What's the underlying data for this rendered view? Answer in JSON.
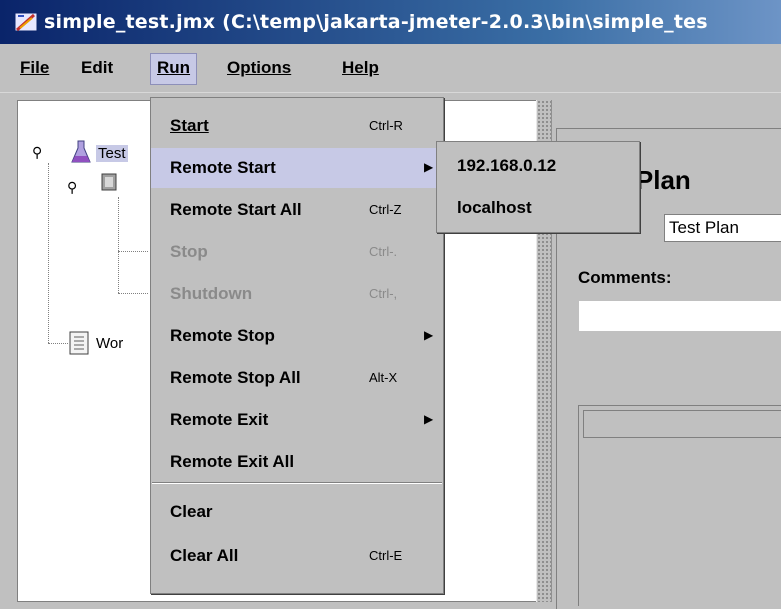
{
  "window": {
    "title": "simple_test.jmx (C:\\temp\\jakarta-jmeter-2.0.3\\bin\\simple_tes"
  },
  "menubar": {
    "items": [
      {
        "key": "file",
        "label": "File"
      },
      {
        "key": "edit",
        "label": "Edit"
      },
      {
        "key": "run",
        "label": "Run",
        "active": true
      },
      {
        "key": "options",
        "label": "Options"
      },
      {
        "key": "help",
        "label": "Help"
      }
    ]
  },
  "run_menu": {
    "items": [
      {
        "label": "Start",
        "accel": "Ctrl-R",
        "enabled": true
      },
      {
        "label": "Remote Start",
        "accel": "",
        "submenu": true,
        "enabled": true,
        "highlighted": true
      },
      {
        "label": "Remote Start All",
        "accel": "Ctrl-Z",
        "enabled": true
      },
      {
        "label": "Stop",
        "accel": "Ctrl-.",
        "enabled": false
      },
      {
        "label": "Shutdown",
        "accel": "Ctrl-,",
        "enabled": false
      },
      {
        "label": "Remote Stop",
        "accel": "",
        "submenu": true,
        "enabled": true
      },
      {
        "label": "Remote Stop All",
        "accel": "Alt-X",
        "enabled": true
      },
      {
        "label": "Remote Exit",
        "accel": "",
        "submenu": true,
        "enabled": true
      },
      {
        "label": "Remote Exit All",
        "accel": "",
        "enabled": true
      },
      {
        "label": "Clear",
        "accel": "",
        "enabled": true
      },
      {
        "label": "Clear All",
        "accel": "Ctrl-E",
        "enabled": true
      }
    ]
  },
  "remote_start_submenu": {
    "items": [
      {
        "label": "192.168.0.12"
      },
      {
        "label": "localhost"
      }
    ]
  },
  "tree": {
    "nodes": [
      {
        "label": "Test"
      },
      {
        "label": "Wor"
      }
    ]
  },
  "editor": {
    "plan_title": ": Plan",
    "name_label": ":",
    "name_value": "Test Plan",
    "comments_label": "Comments:"
  },
  "colors": {
    "menu_highlight": "#c7c9e6",
    "title_bar": "#0a246a",
    "background": "#c0c0c0",
    "disabled_text": "#8a8a8a"
  }
}
